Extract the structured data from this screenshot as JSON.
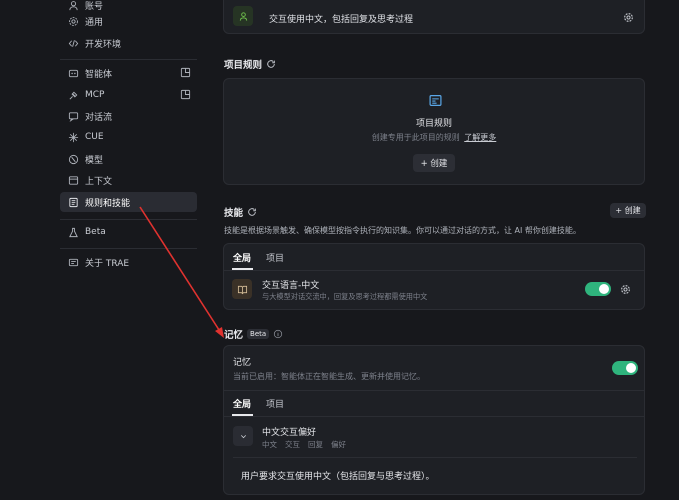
{
  "sidebar": {
    "items": [
      {
        "label": "账号",
        "icon": "user-icon"
      },
      {
        "label": "通用",
        "icon": "gear-icon"
      },
      {
        "label": "开发环境",
        "icon": "code-icon"
      },
      {
        "label": "智能体",
        "icon": "agent-icon"
      },
      {
        "label": "MCP",
        "icon": "plug-icon"
      },
      {
        "label": "对话流",
        "icon": "flow-icon"
      },
      {
        "label": "CUE",
        "icon": "spark-icon"
      },
      {
        "label": "模型",
        "icon": "model-icon"
      },
      {
        "label": "上下文",
        "icon": "context-icon"
      },
      {
        "label": "规则和技能",
        "icon": "rules-icon"
      },
      {
        "label": "Beta",
        "icon": "flask-icon"
      },
      {
        "label": "关于 TRAE",
        "icon": "info-card-icon"
      }
    ]
  },
  "top_rule": {
    "text": "交互使用中文，包括回复及思考过程"
  },
  "project_rules": {
    "title": "项目规则",
    "empty_title": "项目规则",
    "empty_desc": "创建专用于此项目的规则",
    "learn_more": "了解更多",
    "create_label": "+ 创建"
  },
  "skills": {
    "title": "技能",
    "create_label": "+ 创建",
    "desc": "技能是根据场景触发、确保模型按指令执行的知识集。你可以通过对话的方式，让 AI 帮你创建技能。",
    "tabs": [
      "全局",
      "项目"
    ],
    "item": {
      "name": "交互语言-中文",
      "desc": "与大模型对话交流中，回复及思考过程都需使用中文"
    }
  },
  "memory": {
    "title": "记忆",
    "badge": "Beta",
    "card_title": "记忆",
    "card_desc": "当前已启用：智能体正在智能生成、更新并使用记忆。",
    "tabs": [
      "全局",
      "项目"
    ],
    "item": {
      "name": "中文交互偏好",
      "tags": [
        "中文",
        "交互",
        "回复",
        "偏好"
      ]
    },
    "content": "用户要求交互使用中文（包括回复与思考过程）。"
  },
  "colors": {
    "accent_toggle": "#2fb47d",
    "background": "#17181c",
    "card": "#1e2025",
    "annotation_arrow": "#e0322f"
  }
}
